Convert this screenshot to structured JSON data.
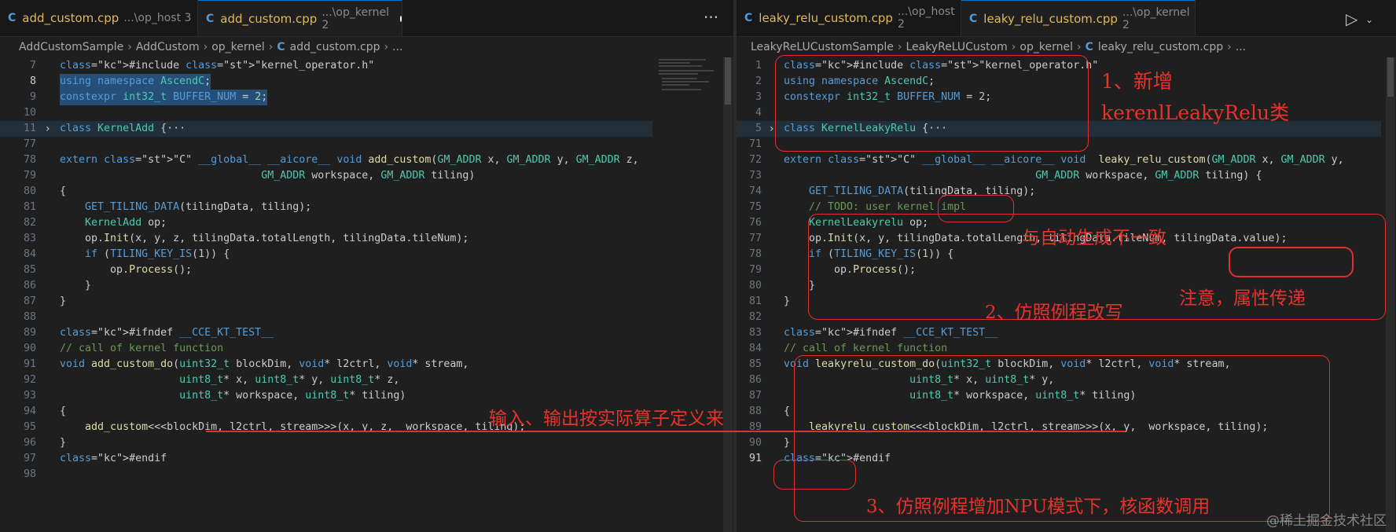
{
  "left": {
    "tabs": [
      {
        "name": "add_custom.cpp",
        "path": "...\\op_host 3",
        "active": false
      },
      {
        "name": "add_custom.cpp",
        "path": "...\\op_kernel 2",
        "active": true
      }
    ],
    "more": "···",
    "breadcrumb": [
      "AddCustomSample",
      "AddCustom",
      "op_kernel",
      "add_custom.cpp",
      "..."
    ],
    "lines": [
      {
        "n": "7",
        "t": "#include \"kernel_operator.h\""
      },
      {
        "n": "8",
        "t": "using namespace AscendC;"
      },
      {
        "n": "9",
        "t": "constexpr int32_t BUFFER_NUM = 2;"
      },
      {
        "n": "10",
        "t": ""
      },
      {
        "n": "11",
        "t": "class KernelAdd {···"
      },
      {
        "n": "77",
        "t": ""
      },
      {
        "n": "78",
        "t": "extern \"C\" __global__ __aicore__ void add_custom(GM_ADDR x, GM_ADDR y, GM_ADDR z,"
      },
      {
        "n": "79",
        "t": "                                GM_ADDR workspace, GM_ADDR tiling)"
      },
      {
        "n": "80",
        "t": "{"
      },
      {
        "n": "81",
        "t": "    GET_TILING_DATA(tilingData, tiling);"
      },
      {
        "n": "82",
        "t": "    KernelAdd op;"
      },
      {
        "n": "83",
        "t": "    op.Init(x, y, z, tilingData.totalLength, tilingData.tileNum);"
      },
      {
        "n": "84",
        "t": "    if (TILING_KEY_IS(1)) {"
      },
      {
        "n": "85",
        "t": "        op.Process();"
      },
      {
        "n": "86",
        "t": "    }"
      },
      {
        "n": "87",
        "t": "}"
      },
      {
        "n": "88",
        "t": ""
      },
      {
        "n": "89",
        "t": "#ifndef __CCE_KT_TEST__"
      },
      {
        "n": "90",
        "t": "// call of kernel function"
      },
      {
        "n": "91",
        "t": "void add_custom_do(uint32_t blockDim, void* l2ctrl, void* stream,"
      },
      {
        "n": "92",
        "t": "                   uint8_t* x, uint8_t* y, uint8_t* z,"
      },
      {
        "n": "93",
        "t": "                   uint8_t* workspace, uint8_t* tiling)"
      },
      {
        "n": "94",
        "t": "{"
      },
      {
        "n": "95",
        "t": "    add_custom<<<blockDim, l2ctrl, stream>>>(x, y, z,  workspace, tiling);"
      },
      {
        "n": "96",
        "t": "}"
      },
      {
        "n": "97",
        "t": "#endif"
      },
      {
        "n": "98",
        "t": ""
      }
    ]
  },
  "right": {
    "tabs": [
      {
        "name": "leaky_relu_custom.cpp",
        "path": "...\\op_host 2",
        "active": false
      },
      {
        "name": "leaky_relu_custom.cpp",
        "path": "...\\op_kernel 2",
        "active": true
      }
    ],
    "breadcrumb": [
      "LeakyReLUCustomSample",
      "LeakyReLUCustom",
      "op_kernel",
      "leaky_relu_custom.cpp",
      "..."
    ],
    "lines": [
      {
        "n": "1",
        "t": "#include \"kernel_operator.h\""
      },
      {
        "n": "2",
        "t": "using namespace AscendC;"
      },
      {
        "n": "3",
        "t": "constexpr int32_t BUFFER_NUM = 2;"
      },
      {
        "n": "4",
        "t": ""
      },
      {
        "n": "5",
        "t": "class KernelLeakyRelu {···"
      },
      {
        "n": "71",
        "t": ""
      },
      {
        "n": "72",
        "t": "extern \"C\" __global__ __aicore__ void  leaky_relu_custom(GM_ADDR x, GM_ADDR y,"
      },
      {
        "n": "73",
        "t": "                                        GM_ADDR workspace, GM_ADDR tiling) {"
      },
      {
        "n": "74",
        "t": "    GET_TILING_DATA(tilingData, tiling);"
      },
      {
        "n": "75",
        "t": "    // TODO: user kernel impl"
      },
      {
        "n": "76",
        "t": "    KernelLeakyrelu op;"
      },
      {
        "n": "77",
        "t": "    op.Init(x, y, tilingData.totalLength, tilingData.tileNum, tilingData.value);"
      },
      {
        "n": "78",
        "t": "    if (TILING_KEY_IS(1)) {"
      },
      {
        "n": "79",
        "t": "        op.Process();"
      },
      {
        "n": "80",
        "t": "    }"
      },
      {
        "n": "81",
        "t": "}"
      },
      {
        "n": "82",
        "t": ""
      },
      {
        "n": "83",
        "t": "#ifndef __CCE_KT_TEST__"
      },
      {
        "n": "84",
        "t": "// call of kernel function"
      },
      {
        "n": "85",
        "t": "void leakyrelu_custom_do(uint32_t blockDim, void* l2ctrl, void* stream,"
      },
      {
        "n": "86",
        "t": "                    uint8_t* x, uint8_t* y,"
      },
      {
        "n": "87",
        "t": "                    uint8_t* workspace, uint8_t* tiling)"
      },
      {
        "n": "88",
        "t": "{"
      },
      {
        "n": "89",
        "t": "    leakyrelu_custom<<<blockDim, l2ctrl, stream>>>(x, y,  workspace, tiling);"
      },
      {
        "n": "90",
        "t": "}"
      },
      {
        "n": "91",
        "t": "#endif"
      }
    ]
  },
  "annotations": {
    "a1_line1": "1、新增",
    "a1_line2": "kerenlLeakyRelu类",
    "a2": "与自动生成不一致",
    "a3": "2、仿照例程改写",
    "a4": "注意，属性传递",
    "a5": "输入、输出按实际算子定义来",
    "a6": "3、仿照例程增加NPU模式下，核函数调用"
  },
  "watermark": "@稀土掘金技术社区",
  "colors": {
    "annotation": "#e03030",
    "keyword": "#569cd6",
    "type": "#4ec9b0",
    "function": "#dcdcaa",
    "string": "#ce9178",
    "comment": "#6a9955"
  }
}
